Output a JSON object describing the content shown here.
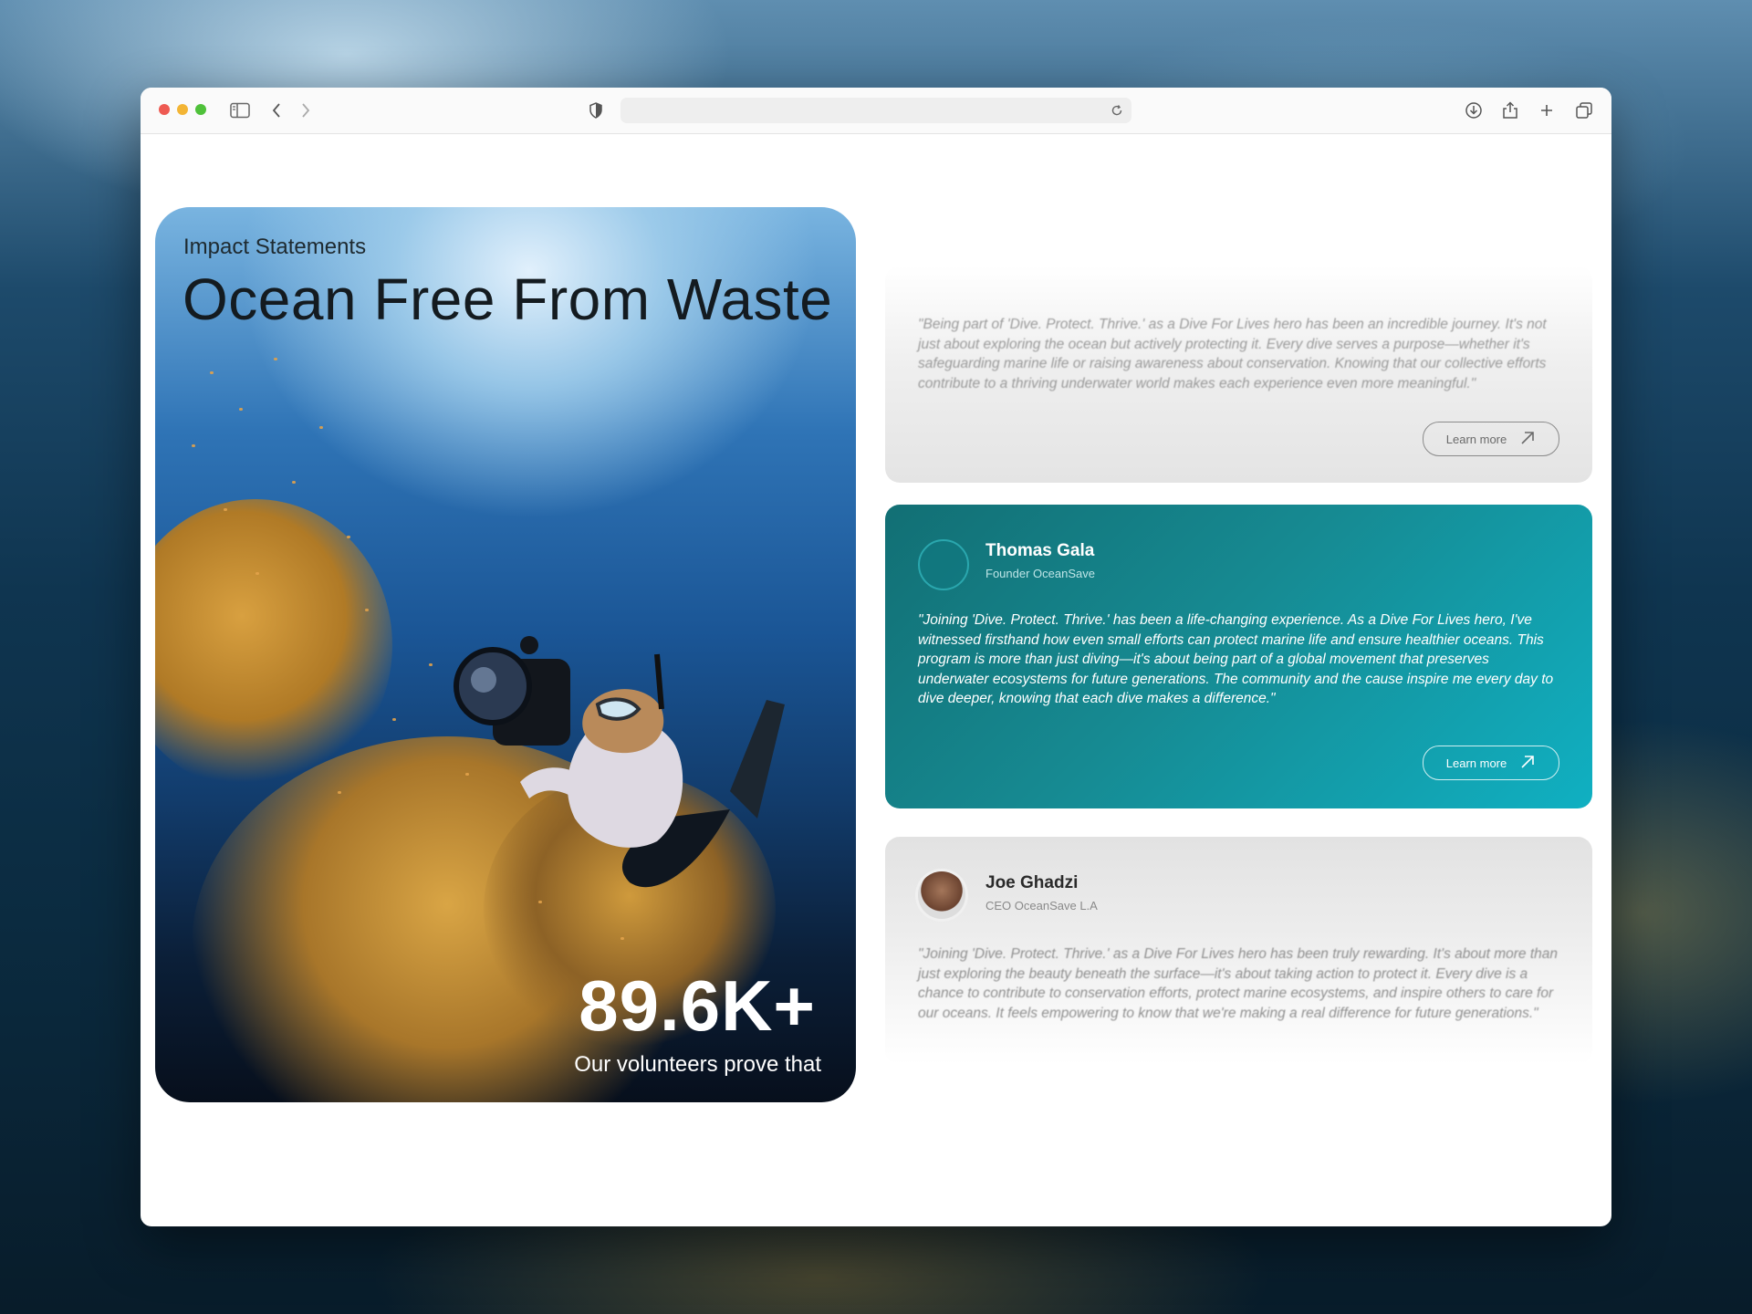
{
  "hero": {
    "eyebrow": "Impact Statements",
    "title": "Ocean Free From Waste",
    "stat_value": "89.6K+",
    "stat_label": "Our volunteers prove that"
  },
  "testimonials": [
    {
      "name": "",
      "role": "",
      "quote": "\"Being part of 'Dive. Protect. Thrive.' as a Dive For Lives hero has been an incredible journey. It's not just about exploring the ocean but actively protecting it. Every dive serves a purpose—whether it's safeguarding marine life or raising awareness about conservation. Knowing that our collective efforts contribute to a thriving underwater world makes each experience even more meaningful.\"",
      "button": "Learn more"
    },
    {
      "name": "Thomas Gala",
      "role": "Founder OceanSave",
      "quote": "\"Joining 'Dive. Protect. Thrive.' has been a life-changing experience. As a Dive For Lives hero, I've witnessed firsthand how even small efforts can protect marine life and ensure healthier oceans. This program is more than just diving—it's about being part of a global movement that preserves underwater ecosystems for future generations. The community and the cause inspire me every day to dive deeper, knowing that each dive makes a difference.\"",
      "button": "Learn more"
    },
    {
      "name": "Joe Ghadzi",
      "role": "CEO OceanSave L.A",
      "quote": "\"Joining 'Dive. Protect. Thrive.' as a Dive For Lives hero has been truly rewarding. It's about more than just exploring the beauty beneath the surface—it's about taking action to protect it. Every dive is a chance to contribute to conservation efforts, protect marine ecosystems, and inspire others to care for our oceans. It feels empowering to know that we're making a real difference for future generations.\""
    }
  ],
  "colors": {
    "accent_teal": "#168a92",
    "accent_teal_light": "#10b0c2"
  },
  "icons": {
    "toolbar": [
      "sidebar-icon",
      "back-icon",
      "forward-icon",
      "shield-icon",
      "reload-icon",
      "download-icon",
      "share-icon",
      "new-tab-icon",
      "tabs-overview-icon"
    ],
    "button": "arrow-up-right-icon"
  }
}
